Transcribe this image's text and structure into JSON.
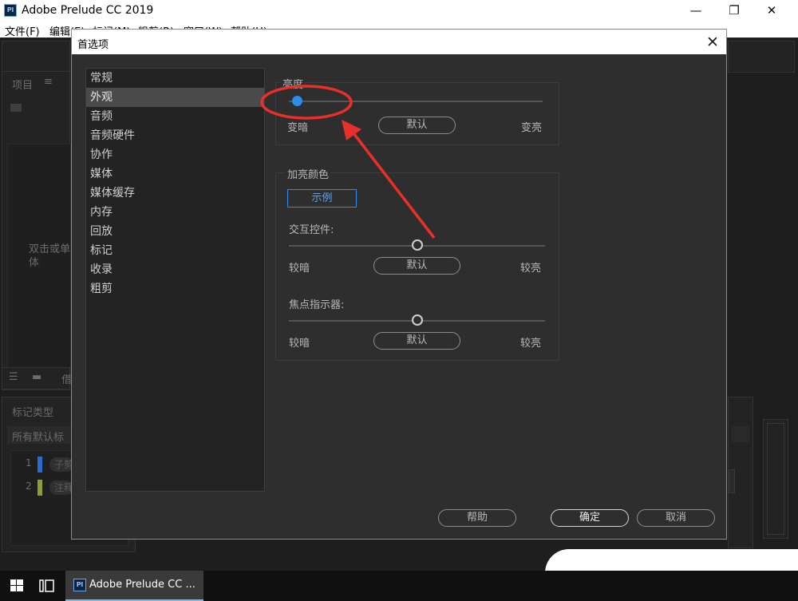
{
  "app": {
    "logo": "Pl",
    "title": "Adobe Prelude CC 2019",
    "window_controls": {
      "minimize": "—",
      "maximize": "❐",
      "close": "✕"
    }
  },
  "menu": [
    "文件(F)",
    "编辑(E)",
    "标记(M)",
    "粗剪(R)",
    "窗口(W)",
    "帮助(H)"
  ],
  "background": {
    "project_panel_title": "项目",
    "project_hint": "双击或单",
    "project_hint2": "体",
    "marker_panel_title": "标记类型",
    "marker_filter": "所有默认标",
    "marker_rows": [
      {
        "num": "1",
        "label": "子剪",
        "color": "#2d6ccf"
      },
      {
        "num": "2",
        "label": "注释",
        "color": "#8f9c3a"
      }
    ],
    "toolbar_glyph": "借"
  },
  "dialog": {
    "title": "首选项",
    "categories": [
      "常规",
      "外观",
      "音频",
      "音频硬件",
      "协作",
      "媒体",
      "媒体缓存",
      "内存",
      "回放",
      "标记",
      "收录",
      "粗剪"
    ],
    "selected_index": 1,
    "brightness": {
      "label": "亮度",
      "min_label": "变暗",
      "max_label": "变亮",
      "default_button": "默认",
      "value": 0.0
    },
    "highlight": {
      "group_label": "加亮颜色",
      "sample_button": "示例",
      "sample_color": "#2d8ceb",
      "interactive": {
        "label": "交互控件:",
        "min_label": "较暗",
        "max_label": "较亮",
        "default_button": "默认",
        "value": 0.5
      },
      "focus": {
        "label": "焦点指示器:",
        "min_label": "较暗",
        "max_label": "较亮",
        "default_button": "默认",
        "value": 0.5
      }
    },
    "buttons": {
      "help": "帮助",
      "ok": "确定",
      "cancel": "取消"
    }
  },
  "taskbar": {
    "task_label": "Adobe Prelude CC ...",
    "task_icon": "Pl"
  },
  "annotation": {
    "color": "#e8302a"
  }
}
